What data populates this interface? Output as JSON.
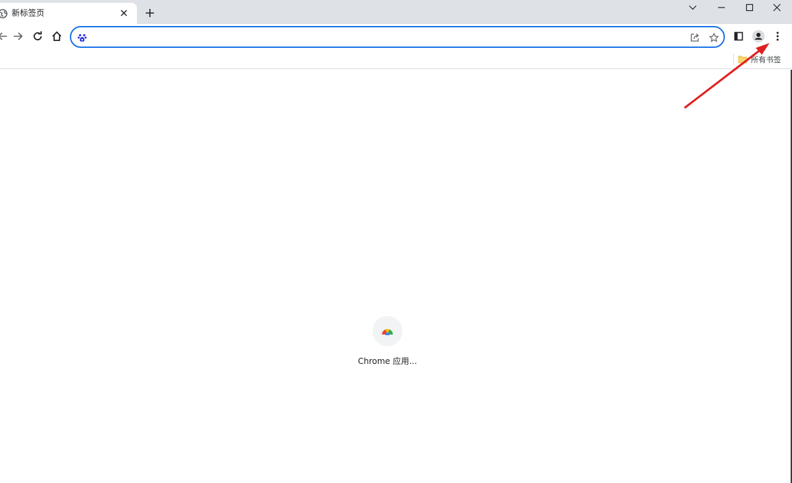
{
  "tab": {
    "title": "新标签页",
    "favicon": "globe-icon"
  },
  "window_controls": [
    "chevron-down-icon",
    "minimize-icon",
    "maximize-icon",
    "close-icon"
  ],
  "omnibox": {
    "value": "",
    "placeholder": "",
    "search_engine_icon": "baidu-paw-icon"
  },
  "bookmarks_bar": {
    "all_bookmarks_label": "所有书签"
  },
  "shortcuts": [
    {
      "label": "Chrome 应用...",
      "icon": "chrome-web-store-icon"
    }
  ],
  "annotation": {
    "color": "#e02020",
    "points_to": "chrome-menu-button"
  },
  "colors": {
    "accent": "#1a73e8",
    "tabstrip": "#dee1e6"
  }
}
